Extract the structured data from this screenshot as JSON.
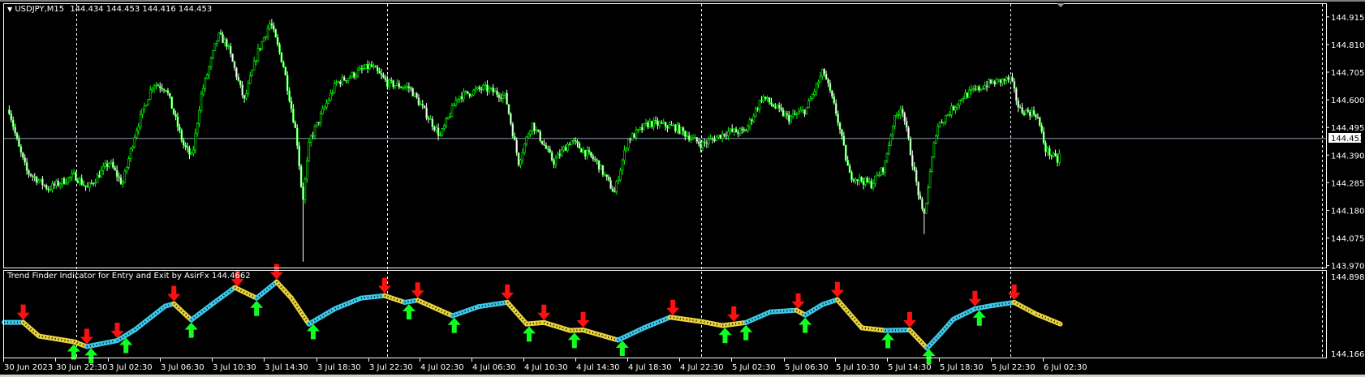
{
  "header": {
    "symbol": "USDJPY,M15",
    "ohlc": "144.434 144.453 144.416 144.453"
  },
  "indicator": {
    "title": "Trend Finder Indicator for Entry and Exit by AsirFx 144.4662",
    "axis_max": "144.8986",
    "axis_min": "144.1666",
    "range": [
      144.1666,
      144.8986
    ],
    "colors": {
      "up": "#3cc8e8",
      "down": "#e8d23c",
      "sell": "#ff1010",
      "buy": "#10ff20"
    },
    "points": [
      [
        0,
        144.471,
        "up"
      ],
      [
        22,
        144.471,
        "up"
      ],
      [
        40,
        144.342,
        "down"
      ],
      [
        80,
        144.289,
        "down"
      ],
      [
        95,
        144.243,
        "down"
      ],
      [
        130,
        144.3,
        "up"
      ],
      [
        150,
        144.4,
        "up"
      ],
      [
        185,
        144.624,
        "up"
      ],
      [
        195,
        144.647,
        "up"
      ],
      [
        215,
        144.494,
        "down"
      ],
      [
        240,
        144.65,
        "up"
      ],
      [
        265,
        144.8,
        "up"
      ],
      [
        285,
        144.72,
        "down"
      ],
      [
        290,
        144.7,
        "down"
      ],
      [
        313,
        144.853,
        "up"
      ],
      [
        330,
        144.7,
        "down"
      ],
      [
        350,
        144.456,
        "down"
      ],
      [
        380,
        144.6,
        "up"
      ],
      [
        410,
        144.7,
        "up"
      ],
      [
        437,
        144.723,
        "up"
      ],
      [
        460,
        144.66,
        "down"
      ],
      [
        475,
        144.68,
        "up"
      ],
      [
        515,
        144.533,
        "down"
      ],
      [
        545,
        144.62,
        "up"
      ],
      [
        578,
        144.66,
        "up"
      ],
      [
        600,
        144.456,
        "down"
      ],
      [
        620,
        144.47,
        "down"
      ],
      [
        650,
        144.395,
        "down"
      ],
      [
        665,
        144.4,
        "down"
      ],
      [
        705,
        144.304,
        "down"
      ],
      [
        735,
        144.42,
        "up"
      ],
      [
        765,
        144.52,
        "up"
      ],
      [
        800,
        144.48,
        "down"
      ],
      [
        825,
        144.441,
        "down"
      ],
      [
        852,
        144.47,
        "down"
      ],
      [
        880,
        144.57,
        "up"
      ],
      [
        910,
        144.586,
        "up"
      ],
      [
        920,
        144.54,
        "down"
      ],
      [
        940,
        144.64,
        "up"
      ],
      [
        957,
        144.685,
        "up"
      ],
      [
        985,
        144.42,
        "down"
      ],
      [
        1012,
        144.395,
        "down"
      ],
      [
        1040,
        144.4,
        "up"
      ],
      [
        1060,
        144.228,
        "down"
      ],
      [
        1075,
        144.36,
        "up"
      ],
      [
        1090,
        144.5,
        "up"
      ],
      [
        1115,
        144.6,
        "up"
      ],
      [
        1135,
        144.63,
        "up"
      ],
      [
        1160,
        144.66,
        "up"
      ],
      [
        1185,
        144.55,
        "down"
      ],
      [
        1213,
        144.456,
        "down"
      ]
    ],
    "sell_signals": [
      22,
      95,
      130,
      195,
      268,
      313,
      437,
      475,
      578,
      620,
      665,
      768,
      838,
      912,
      957,
      1040,
      1115,
      1160
    ],
    "buy_signals": [
      80,
      100,
      140,
      215,
      290,
      355,
      465,
      517,
      603,
      655,
      710,
      828,
      852,
      920,
      1015,
      1062,
      1120
    ]
  },
  "price_axis": {
    "ticks": [
      "144.915",
      "144.810",
      "144.705",
      "144.600",
      "144.495",
      "144.390",
      "144.285",
      "144.180",
      "144.075",
      "143.970"
    ],
    "current": "144.453",
    "range": [
      143.97,
      144.915
    ]
  },
  "time_axis": {
    "labels": [
      "30 Jun 2023",
      "30 Jun 22:30",
      "3 Jul 02:30",
      "3 Jul 06:30",
      "3 Jul 10:30",
      "3 Jul 14:30",
      "3 Jul 18:30",
      "3 Jul 22:30",
      "4 Jul 02:30",
      "4 Jul 06:30",
      "4 Jul 10:30",
      "4 Jul 14:30",
      "4 Jul 18:30",
      "4 Jul 22:30",
      "5 Jul 02:30",
      "5 Jul 06:30",
      "5 Jul 10:30",
      "5 Jul 14:30",
      "5 Jul 18:30",
      "5 Jul 22:30",
      "6 Jul 02:30"
    ]
  },
  "chart_data": {
    "type": "candlestick",
    "symbol": "USDJPY",
    "timeframe": "M15",
    "x_unit": "bar",
    "ylim": [
      143.97,
      144.915
    ],
    "current_price": 144.453,
    "colors": {
      "bull": "#00ff00",
      "bear": "#ffffff",
      "grid": "#ffffff",
      "current_line": "#8899aa"
    },
    "path": [
      [
        5,
        144.562
      ],
      [
        15,
        144.429
      ],
      [
        25,
        144.329
      ],
      [
        50,
        144.263
      ],
      [
        80,
        144.313
      ],
      [
        95,
        144.263
      ],
      [
        120,
        144.363
      ],
      [
        135,
        144.279
      ],
      [
        150,
        144.479
      ],
      [
        170,
        144.662
      ],
      [
        185,
        144.645
      ],
      [
        205,
        144.429
      ],
      [
        215,
        144.379
      ],
      [
        225,
        144.612
      ],
      [
        245,
        144.845
      ],
      [
        255,
        144.812
      ],
      [
        275,
        144.596
      ],
      [
        290,
        144.779
      ],
      [
        305,
        144.895
      ],
      [
        320,
        144.729
      ],
      [
        335,
        144.462
      ],
      [
        342,
        144.213
      ],
      [
        350,
        144.446
      ],
      [
        380,
        144.662
      ],
      [
        420,
        144.729
      ],
      [
        440,
        144.662
      ],
      [
        465,
        144.645
      ],
      [
        500,
        144.462
      ],
      [
        520,
        144.612
      ],
      [
        550,
        144.645
      ],
      [
        575,
        144.612
      ],
      [
        590,
        144.363
      ],
      [
        605,
        144.512
      ],
      [
        630,
        144.363
      ],
      [
        650,
        144.446
      ],
      [
        680,
        144.363
      ],
      [
        700,
        144.246
      ],
      [
        715,
        144.446
      ],
      [
        740,
        144.512
      ],
      [
        770,
        144.496
      ],
      [
        800,
        144.429
      ],
      [
        830,
        144.479
      ],
      [
        850,
        144.479
      ],
      [
        870,
        144.612
      ],
      [
        900,
        144.529
      ],
      [
        920,
        144.562
      ],
      [
        940,
        144.712
      ],
      [
        955,
        144.546
      ],
      [
        970,
        144.313
      ],
      [
        995,
        144.279
      ],
      [
        1010,
        144.346
      ],
      [
        1020,
        144.512
      ],
      [
        1030,
        144.579
      ],
      [
        1045,
        144.313
      ],
      [
        1055,
        144.146
      ],
      [
        1070,
        144.496
      ],
      [
        1100,
        144.612
      ],
      [
        1130,
        144.662
      ],
      [
        1155,
        144.679
      ],
      [
        1165,
        144.562
      ],
      [
        1185,
        144.546
      ],
      [
        1195,
        144.412
      ],
      [
        1210,
        144.363
      ],
      [
        1213,
        144.453
      ]
    ],
    "spikes": [
      [
        342,
        143.985
      ],
      [
        1055,
        144.09
      ]
    ]
  }
}
